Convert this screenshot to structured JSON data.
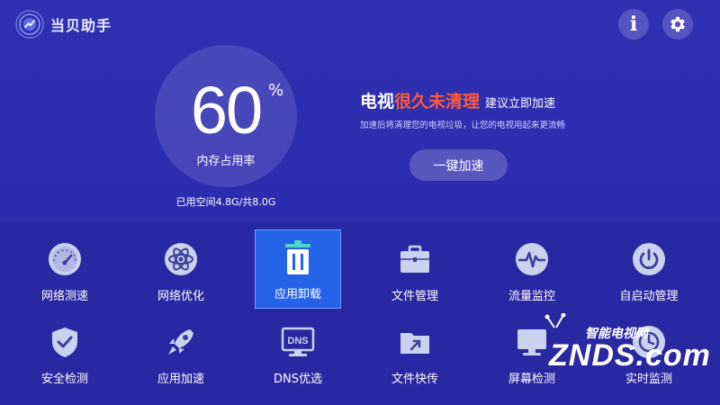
{
  "app": {
    "title": "当贝助手"
  },
  "header": {
    "info_label": "i"
  },
  "memory": {
    "percent_value": "60",
    "percent_unit": "%",
    "label": "内存占用率",
    "space_text": "已用空间4.8G/共8.0G"
  },
  "message": {
    "part1": "电视",
    "accent": "很久未清理",
    "part2": "建议立即加速",
    "subtext": "加速后将清理您的电视垃圾，让您的电视用起来更流畅",
    "accent_color": "#ff5a3c"
  },
  "speed_button": {
    "label": "一键加速"
  },
  "tools": [
    {
      "label": "网络测速",
      "icon": "speedometer-icon"
    },
    {
      "label": "网络优化",
      "icon": "atom-icon"
    },
    {
      "label": "应用卸载",
      "icon": "trash-icon",
      "selected": true
    },
    {
      "label": "文件管理",
      "icon": "toolbox-icon"
    },
    {
      "label": "流量监控",
      "icon": "pulse-icon"
    },
    {
      "label": "自启动管理",
      "icon": "power-icon"
    },
    {
      "label": "安全检测",
      "icon": "shield-check-icon"
    },
    {
      "label": "应用加速",
      "icon": "rocket-icon"
    },
    {
      "label": "DNS优选",
      "icon": "dns-monitor-icon",
      "icon_text": "DNS"
    },
    {
      "label": "文件快传",
      "icon": "folder-share-icon"
    },
    {
      "label": "屏幕检测",
      "icon": "monitor-icon"
    },
    {
      "label": "实时监测",
      "icon": "realtime-monitor-icon"
    }
  ],
  "watermark": {
    "top": "智能电视网",
    "main": "ZNDS.com"
  }
}
